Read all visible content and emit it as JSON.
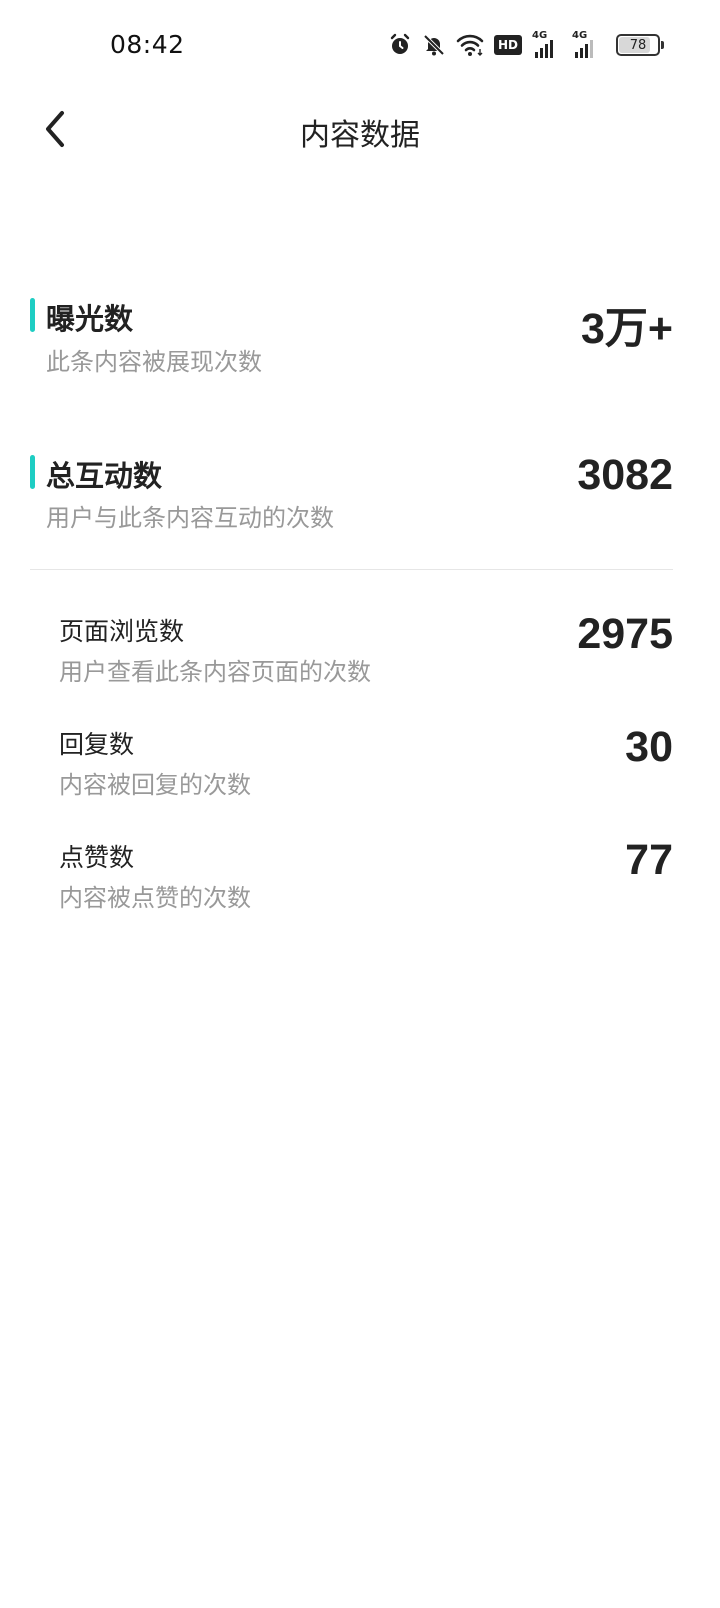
{
  "status_bar": {
    "time": "08:42",
    "icons": [
      "alarm-icon",
      "bell-off-icon",
      "wifi-icon",
      "hd-icon",
      "signal-4g-icon",
      "signal-4g-icon",
      "battery-icon"
    ],
    "hd_label": "HD",
    "network_label_1": "4G",
    "network_label_2": "4G",
    "battery_level": "78"
  },
  "header": {
    "title": "内容数据",
    "back_icon": "chevron-left-icon"
  },
  "colors": {
    "accent": "#1ecdc3",
    "text_primary": "#222222",
    "text_secondary": "#999999",
    "divider": "#e6e6e6"
  },
  "metrics": {
    "exposure": {
      "title": "曝光数",
      "description": "此条内容被展现次数",
      "value": "3万+"
    },
    "interactions": {
      "title": "总互动数",
      "description": "用户与此条内容互动的次数",
      "value": "3082"
    }
  },
  "sub_metrics": {
    "page_views": {
      "title": "页面浏览数",
      "description": "用户查看此条内容页面的次数",
      "value": "2975"
    },
    "replies": {
      "title": "回复数",
      "description": "内容被回复的次数",
      "value": "30"
    },
    "likes": {
      "title": "点赞数",
      "description": "内容被点赞的次数",
      "value": "77"
    }
  }
}
